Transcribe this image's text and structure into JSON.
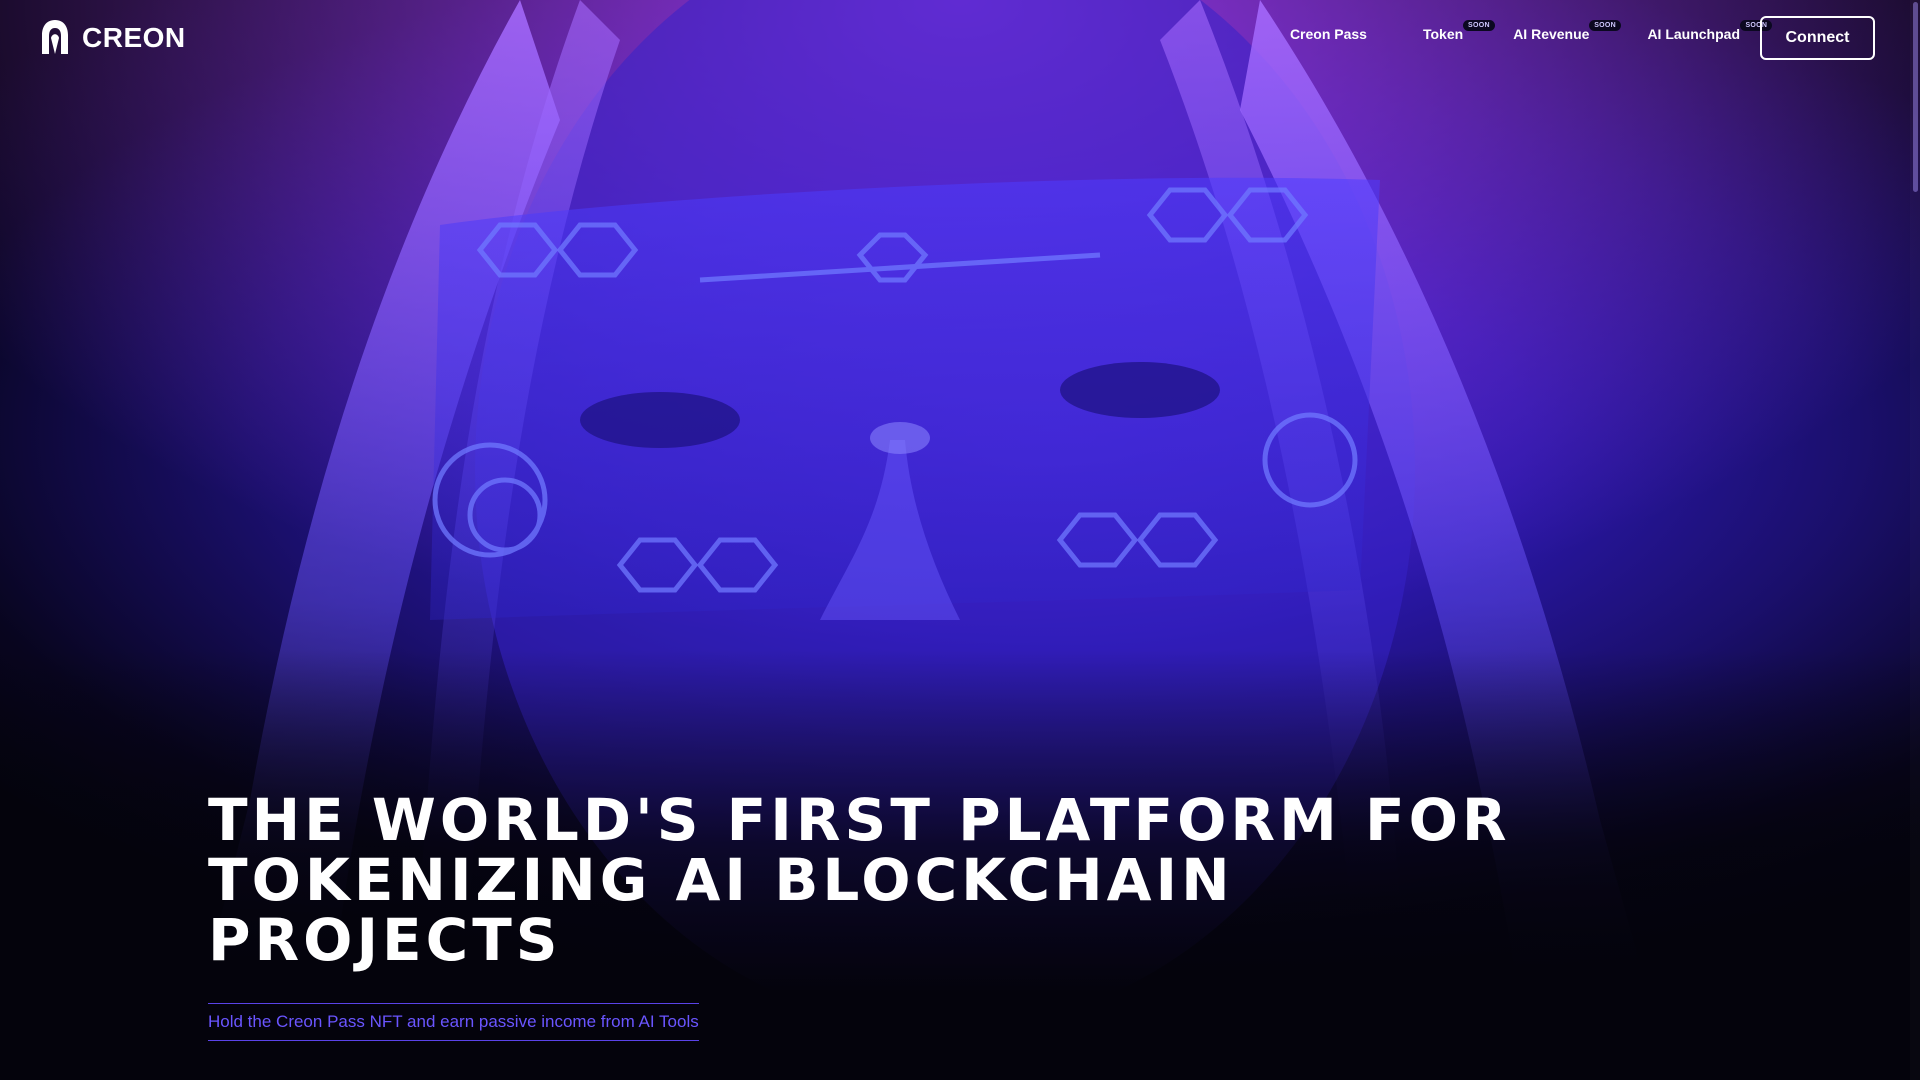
{
  "brand": {
    "name": "CREON"
  },
  "nav": {
    "items": [
      {
        "label": "Creon Pass",
        "badge": ""
      },
      {
        "label": "Token",
        "badge": "SOON"
      },
      {
        "label": "AI Revenue",
        "badge": "SOON"
      },
      {
        "label": "AI Launchpad",
        "badge": "SOON"
      }
    ],
    "connect_label": "Connect"
  },
  "hero": {
    "headline_lines": [
      "THE WORLD'S FIRST PLATFORM FOR",
      "TOKENIZING AI BLOCKCHAIN",
      "PROJECTS"
    ],
    "subline": "Hold the Creon Pass NFT and earn passive income from AI Tools"
  },
  "colors": {
    "accent": "#5a43e8",
    "background": "#04030c",
    "hero_glow": "#3d1fd0"
  }
}
